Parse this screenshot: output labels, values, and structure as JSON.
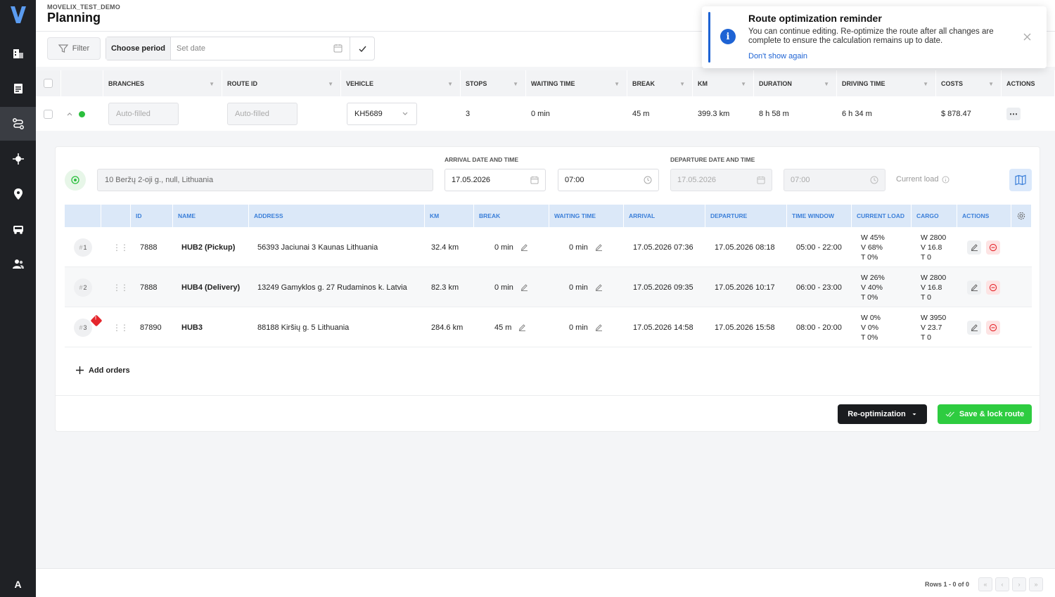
{
  "sidebar": {
    "logo": "V",
    "items": [
      {
        "icon": "building-icon"
      },
      {
        "icon": "document-icon"
      },
      {
        "icon": "route-icon",
        "active": true
      },
      {
        "icon": "crosshair-icon"
      },
      {
        "icon": "location-pin-icon"
      },
      {
        "icon": "truck-icon"
      },
      {
        "icon": "users-icon"
      }
    ],
    "user_initial": "A"
  },
  "header": {
    "org": "MOVELIX_TEST_DEMO",
    "title": "Planning"
  },
  "toolbar": {
    "filter_label": "Filter",
    "period_label": "Choose period",
    "date_placeholder": "Set date"
  },
  "routes_table": {
    "columns": [
      "BRANCHES",
      "ROUTE ID",
      "VEHICLE",
      "STOPS",
      "WAITING TIME",
      "BREAK",
      "KM",
      "DURATION",
      "DRIVING TIME",
      "COSTS",
      "ACTIONS"
    ],
    "row": {
      "branches": "Auto-filled",
      "route_id": "Auto-filled",
      "vehicle": "KH5689",
      "stops": "3",
      "waiting_time": "0 min",
      "break": "45 m",
      "km": "399.3 km",
      "duration": "8 h 58 m",
      "driving_time": "6 h 34 m",
      "costs": "$ 878.47",
      "status_color": "#2bbf3d"
    }
  },
  "route_detail": {
    "start_address": "10 Beržų 2-oji g., null, Lithuania",
    "arrival_label": "ARRIVAL DATE AND TIME",
    "arrival_date": "17.05.2026",
    "arrival_time": "07:00",
    "departure_label": "DEPARTURE DATE AND TIME",
    "departure_date": "17.05.2026",
    "departure_time": "07:00",
    "current_load_label": "Current load",
    "stops_columns": [
      "ID",
      "NAME",
      "ADDRESS",
      "KM",
      "BREAK",
      "WAITING TIME",
      "ARRIVAL",
      "DEPARTURE",
      "TIME WINDOW",
      "CURRENT LOAD",
      "CARGO",
      "ACTIONS"
    ],
    "stops": [
      {
        "num": "1",
        "id": "7888",
        "name": "HUB2 (Pickup)",
        "address": "56393 Jaciunai 3 Kaunas Lithuania",
        "km": "32.4 km",
        "break": "0 min",
        "waiting": "0 min",
        "arrival": "17.05.2026 07:36",
        "departure": "17.05.2026 08:18",
        "window": "05:00 - 22:00",
        "load_w": "W 45%",
        "load_v": "V 68%",
        "load_t": "T 0%",
        "cargo_w": "W 2800",
        "cargo_v": "V 16.8",
        "cargo_t": "T 0"
      },
      {
        "num": "2",
        "id": "7888",
        "name": "HUB4 (Delivery)",
        "address": "13249 Gamyklos g. 27 Rudaminos k. Latvia",
        "km": "82.3 km",
        "break": "0 min",
        "waiting": "0 min",
        "arrival": "17.05.2026 09:35",
        "departure": "17.05.2026 10:17",
        "window": "06:00 - 23:00",
        "load_w": "W 26%",
        "load_v": "V 40%",
        "load_t": "T 0%",
        "cargo_w": "W 2800",
        "cargo_v": "V 16.8",
        "cargo_t": "T 0"
      },
      {
        "num": "3",
        "id": "87890",
        "name": "HUB3",
        "address": "88188 Kiršių g. 5 Lithuania",
        "km": "284.6 km",
        "break": "45 m",
        "waiting": "0 min",
        "arrival": "17.05.2026 14:58",
        "departure": "17.05.2026 15:58",
        "window": "08:00 - 20:00",
        "load_w": "W 0%",
        "load_v": "V 0%",
        "load_t": "T 0%",
        "cargo_w": "W 3950",
        "cargo_v": "V 23.7",
        "cargo_t": "T 0",
        "warning": true
      }
    ],
    "add_orders_label": "Add orders",
    "reoptimize_label": "Re-optimization",
    "save_label": "Save & lock route"
  },
  "footer": {
    "rows_info": "Rows 1 - 0 of 0"
  },
  "toast": {
    "title": "Route optimization reminder",
    "body": "You can continue editing. Re-optimize the route after all changes are complete to ensure the calculation remains up to date.",
    "link": "Don't show again"
  },
  "colors": {
    "accent_blue": "#1e63d4",
    "success_green": "#2ecc40",
    "sidebar_bg": "#1f2125",
    "warning_red": "#e5262c"
  }
}
